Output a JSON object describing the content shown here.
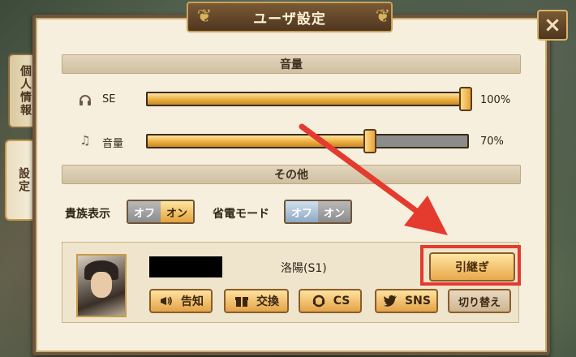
{
  "window": {
    "title": "ユーザ設定",
    "close_icon": "×"
  },
  "side_tabs": [
    {
      "label": "個人情報",
      "active": false
    },
    {
      "label": "設定",
      "active": true
    }
  ],
  "sections": {
    "volume": "音量",
    "other": "その他"
  },
  "volume": {
    "se": {
      "label": "SE",
      "value": 100,
      "value_text": "100%"
    },
    "music": {
      "label": "音量",
      "value": 70,
      "value_text": "70%"
    }
  },
  "toggles": {
    "noble_display": {
      "label": "貴族表示",
      "off": "オフ",
      "on": "オン",
      "state": "on"
    },
    "power_save": {
      "label": "省電モード",
      "off": "オフ",
      "on": "オン",
      "state": "off"
    }
  },
  "account": {
    "server": "洛陽(S1)",
    "transfer_button": "引継ぎ",
    "buttons": {
      "notice": "告知",
      "exchange": "交換",
      "cs": "CS",
      "sns": "SNS",
      "switch": "切り替え"
    }
  },
  "colors": {
    "accent": "#e8a83a",
    "highlight": "#e53a2e",
    "panel": "#f7efdd"
  }
}
